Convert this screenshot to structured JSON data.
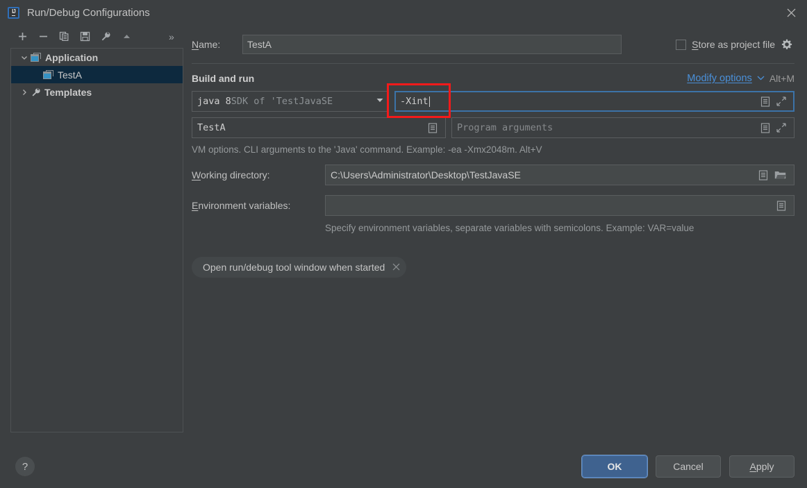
{
  "window": {
    "title": "Run/Debug Configurations",
    "logo_icon": "intellij-idea-logo-icon",
    "close_icon": "close-icon"
  },
  "tree_toolbar": {
    "icons": [
      {
        "name": "add-icon",
        "glyph": "+"
      },
      {
        "name": "remove-icon",
        "glyph": "−"
      },
      {
        "name": "copy-icon",
        "glyph": "copy"
      },
      {
        "name": "save-icon",
        "glyph": "save"
      },
      {
        "name": "edit-templates-icon",
        "glyph": "wrench"
      },
      {
        "name": "move-up-icon",
        "glyph": "▲"
      }
    ],
    "overflow_label": "»"
  },
  "tree": {
    "nodes": [
      {
        "arrow": "⌄",
        "icon": "application-icon",
        "label": "Application",
        "bold": true,
        "selected": false,
        "indent": 0
      },
      {
        "arrow": "",
        "icon": "application-icon",
        "label": "TestA",
        "bold": false,
        "selected": true,
        "indent": 1
      },
      {
        "arrow": "›",
        "icon": "wrench-icon",
        "label": "Templates",
        "bold": true,
        "selected": false,
        "indent": 0
      }
    ]
  },
  "name_row": {
    "label": "Name:",
    "label_mnemonic": "N",
    "label_rest": "ame:",
    "value": "TestA",
    "store_checkbox_checked": false,
    "store_label_mnemonic": "S",
    "store_label_rest": "tore as project file",
    "gear_icon": "gear-icon"
  },
  "build_and_run": {
    "section_title": "Build and run",
    "modify_options_mnemonic": "M",
    "modify_options_rest": "odify options",
    "modify_options_full": "Modify options",
    "chevron_icon": "chevron-down-icon",
    "shortcut": "Alt+M",
    "jre_combo": {
      "strong": "java 8",
      "dim": " SDK of 'TestJavaSE",
      "arrow_icon": "dropdown-arrow-icon"
    },
    "vm_options": {
      "value": "-Xint",
      "focused": true,
      "expand_icon": "expand-icon",
      "list-icon": "macro-list-icon",
      "annotation_highlight_color": "#f41a1a"
    },
    "main_class": {
      "value": "TestA",
      "list_icon": "macro-list-icon"
    },
    "program_arguments": {
      "placeholder": "Program arguments",
      "list_icon": "macro-list-icon",
      "expand_icon": "expand-icon"
    },
    "vm_hint": "VM options. CLI arguments to the 'Java' command. Example: -ea -Xmx2048m. Alt+V"
  },
  "working_directory": {
    "label_mnemonic": "W",
    "label_rest": "orking directory:",
    "value": "C:\\Users\\Administrator\\Desktop\\TestJavaSE",
    "list_icon": "macro-list-icon",
    "browse_icon": "folder-icon"
  },
  "environment_variables": {
    "label_mnemonic": "E",
    "label_rest": "nvironment variables:",
    "value": "",
    "list_icon": "macro-list-icon",
    "hint": "Specify environment variables, separate variables with semicolons. Example: VAR=value"
  },
  "option_chip": {
    "label": "Open run/debug tool window when started",
    "remove_icon": "close-icon"
  },
  "footer": {
    "help_label": "?",
    "ok_label": "OK",
    "cancel_label": "Cancel",
    "apply_mnemonic": "A",
    "apply_rest": "pply",
    "apply_label": "Apply"
  },
  "colors": {
    "background": "#3c3f41",
    "selection": "#0d293e",
    "accent_blue": "#4a90d9",
    "primary_button": "#3f628f",
    "annotation_red": "#f41a1a",
    "field_background": "#45494a"
  }
}
